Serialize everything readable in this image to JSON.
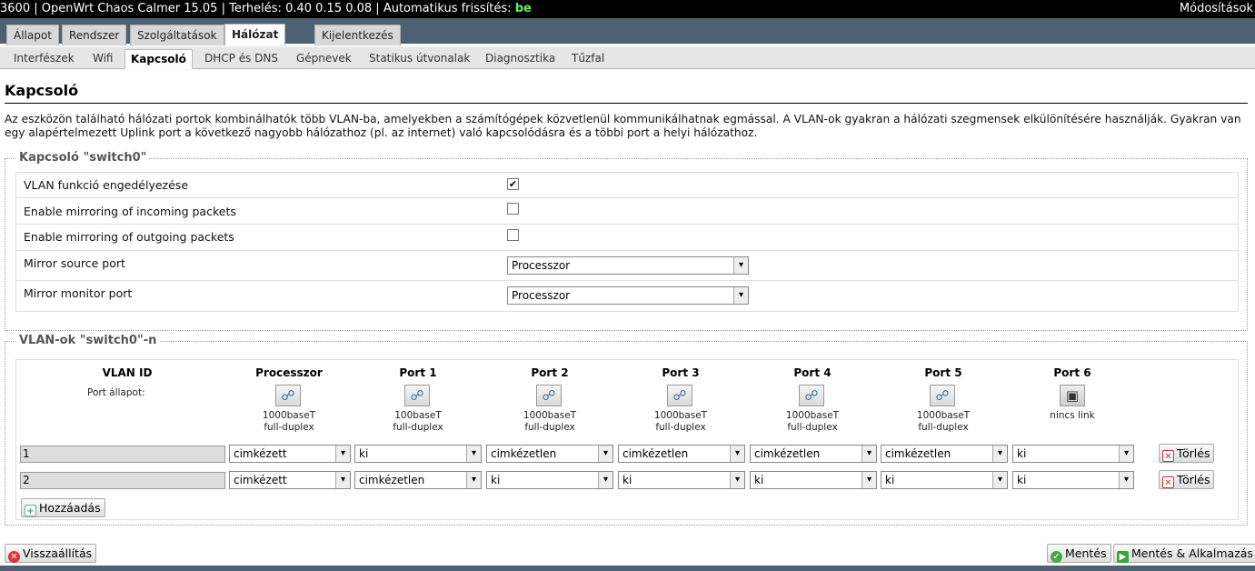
{
  "topbar": {
    "host_prefix": "3600 | OpenWrt Chaos Calmer 15.05 | Terhelés: 0.40 0.15 0.08 | Automatikus frissítés: ",
    "autorefresh": "be",
    "changes": "Módosítások"
  },
  "maintabs": [
    "Állapot",
    "Rendszer",
    "Szolgáltatások",
    "Hálózat",
    "Kijelentkezés"
  ],
  "subtabs": [
    "Interfészek",
    "Wifi",
    "Kapcsoló",
    "DHCP és DNS",
    "Gépnevek",
    "Statikus útvonalak",
    "Diagnosztika",
    "Tűzfal"
  ],
  "page": {
    "title": "Kapcsoló",
    "description": "Az eszközön található hálózati portok kombinálhatók több VLAN-ba, amelyekben a számítógépek közvetlenül kommunikálhatnak egmással. A VLAN-ok gyakran a hálózati szegmensek elkülönítésére használják. Gyakran van egy alapértelmezett Uplink port a következő nagyobb hálózathoz (pl. az internet) való kapcsolódásra és a többi port a helyi hálózathoz."
  },
  "switch": {
    "legend": "Kapcsoló \"switch0\"",
    "vlan_enable_label": "VLAN funkció engedélyezése",
    "vlan_enable_checked": true,
    "mirror_in_label": "Enable mirroring of incoming packets",
    "mirror_in_checked": false,
    "mirror_out_label": "Enable mirroring of outgoing packets",
    "mirror_out_checked": false,
    "mirror_source_label": "Mirror source port",
    "mirror_source_value": "Processzor",
    "mirror_monitor_label": "Mirror monitor port",
    "mirror_monitor_value": "Processzor"
  },
  "vlans": {
    "legend": "VLAN-ok \"switch0\"-n",
    "headers": [
      "VLAN ID",
      "Processzor",
      "Port 1",
      "Port 2",
      "Port 3",
      "Port 4",
      "Port 5",
      "Port 6"
    ],
    "port_state_label": "Port állapot:",
    "port_states": [
      {
        "speed": "1000baseT",
        "duplex": "full-duplex",
        "icon": "ethernet-connected-icon"
      },
      {
        "speed": "100baseT",
        "duplex": "full-duplex",
        "icon": "ethernet-connected-icon"
      },
      {
        "speed": "1000baseT",
        "duplex": "full-duplex",
        "icon": "ethernet-connected-icon"
      },
      {
        "speed": "1000baseT",
        "duplex": "full-duplex",
        "icon": "ethernet-connected-icon"
      },
      {
        "speed": "1000baseT",
        "duplex": "full-duplex",
        "icon": "ethernet-connected-icon"
      },
      {
        "speed": "1000baseT",
        "duplex": "full-duplex",
        "icon": "ethernet-connected-icon"
      },
      {
        "speed": "nincs link",
        "duplex": "",
        "icon": "ethernet-nolink-icon"
      }
    ],
    "rows": [
      {
        "id": "1",
        "ports": [
          "cimkézett",
          "ki",
          "cimkézetlen",
          "cimkézetlen",
          "cimkézetlen",
          "cimkézetlen",
          "ki"
        ]
      },
      {
        "id": "2",
        "ports": [
          "cimkézett",
          "cimkézetlen",
          "ki",
          "ki",
          "ki",
          "ki",
          "ki"
        ]
      }
    ],
    "delete_label": "Törlés",
    "add_label": "Hozzáadás"
  },
  "footer": {
    "reset_label": "Visszaállítás",
    "save_label": "Mentés",
    "apply_label": "Mentés & Alkalmazás"
  }
}
